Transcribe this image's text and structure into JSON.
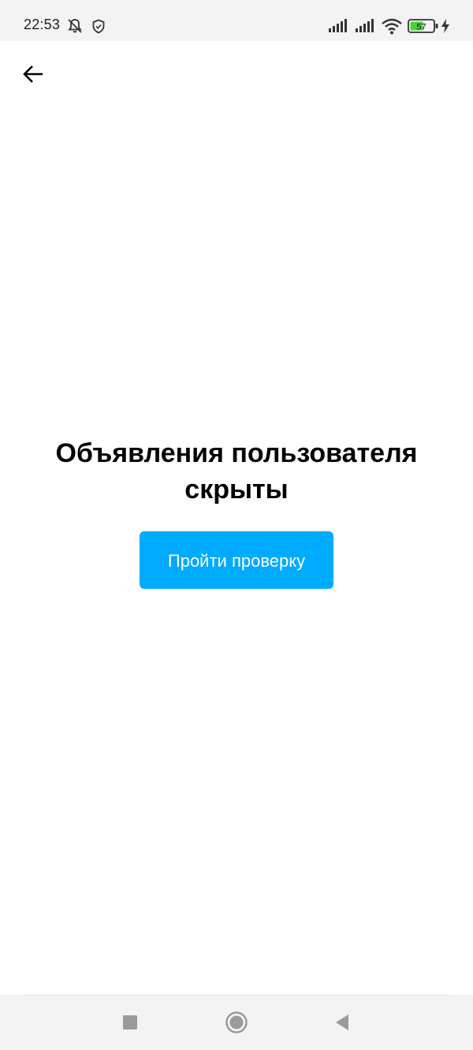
{
  "status_bar": {
    "time": "22:53",
    "battery_level": "57",
    "icons": [
      "muted-notifications-icon",
      "shield-icon",
      "signal-icon",
      "signal-icon",
      "wifi-icon",
      "battery-icon",
      "charging-icon"
    ]
  },
  "header": {
    "back_icon": "arrow-left-icon"
  },
  "main": {
    "title": "Объявления пользователя скрыты",
    "verify_button_label": "Пройти проверку"
  },
  "nav_bar": {
    "icons": [
      "recent-apps-icon",
      "home-icon",
      "back-triangle-icon"
    ]
  },
  "colors": {
    "accent": "#00aaff",
    "battery_fill": "#4cd137",
    "status_bar_bg": "#f3f3f3"
  }
}
